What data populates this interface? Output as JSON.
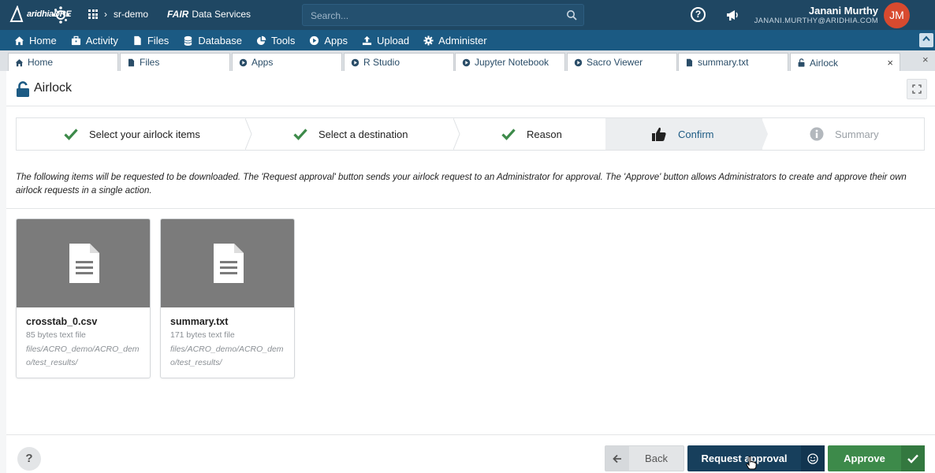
{
  "topbar": {
    "logo_text": "aridhiaDRE",
    "workspace": "sr-demo",
    "fair_bold": "FAIR",
    "fair_label": "Data Services",
    "search_placeholder": "Search...",
    "help_glyph": "?",
    "user_name": "Janani Murthy",
    "user_email": "JANANI.MURTHY@ARIDHIA.COM",
    "avatar_initials": "JM",
    "colors": {
      "bar": "#1f4763",
      "avatar": "#d84a2f"
    }
  },
  "menu": {
    "items": [
      {
        "label": "Home",
        "icon": "home-icon"
      },
      {
        "label": "Activity",
        "icon": "briefcase-icon"
      },
      {
        "label": "Files",
        "icon": "file-icon"
      },
      {
        "label": "Database",
        "icon": "database-icon"
      },
      {
        "label": "Tools",
        "icon": "pie-chart-icon"
      },
      {
        "label": "Apps",
        "icon": "play-circle-icon"
      },
      {
        "label": "Upload",
        "icon": "upload-icon"
      },
      {
        "label": "Administer",
        "icon": "gear-icon"
      }
    ],
    "color": "#1b5a83"
  },
  "tabs": {
    "items": [
      {
        "label": "Home",
        "icon": "home-icon"
      },
      {
        "label": "Files",
        "icon": "file-icon"
      },
      {
        "label": "Apps",
        "icon": "play-circle-icon"
      },
      {
        "label": "R Studio",
        "icon": "play-circle-icon"
      },
      {
        "label": "Jupyter Notebook",
        "icon": "play-circle-icon"
      },
      {
        "label": "Sacro Viewer",
        "icon": "play-circle-icon"
      },
      {
        "label": "summary.txt",
        "icon": "file-icon"
      },
      {
        "label": "Airlock",
        "icon": "unlock-icon",
        "active": true
      }
    ],
    "close_glyph": "×"
  },
  "panel": {
    "title": "Airlock",
    "steps": [
      {
        "label": "Select your airlock items",
        "state": "done"
      },
      {
        "label": "Select a destination",
        "state": "done"
      },
      {
        "label": "Reason",
        "state": "done"
      },
      {
        "label": "Confirm",
        "state": "current"
      },
      {
        "label": "Summary",
        "state": "pending"
      }
    ],
    "info_text": "The following items will be requested to be downloaded. The 'Request approval' button sends your airlock request to an Administrator for approval. The 'Approve' button allows Administrators to create and approve their own airlock requests in a single action.",
    "files": [
      {
        "name": "crosstab_0.csv",
        "meta": "85 bytes text file",
        "path": "files/ACRO_demo/ACRO_demo/test_results/"
      },
      {
        "name": "summary.txt",
        "meta": "171 bytes text file",
        "path": "files/ACRO_demo/ACRO_demo/test_results/"
      }
    ],
    "buttons": {
      "back": "Back",
      "request": "Request approval",
      "approve": "Approve"
    },
    "help_glyph": "?",
    "colors": {
      "check": "#3d8a4a",
      "confirm_text": "#1d5b84",
      "request": "#173f5c",
      "approve": "#3d8a4a"
    }
  }
}
